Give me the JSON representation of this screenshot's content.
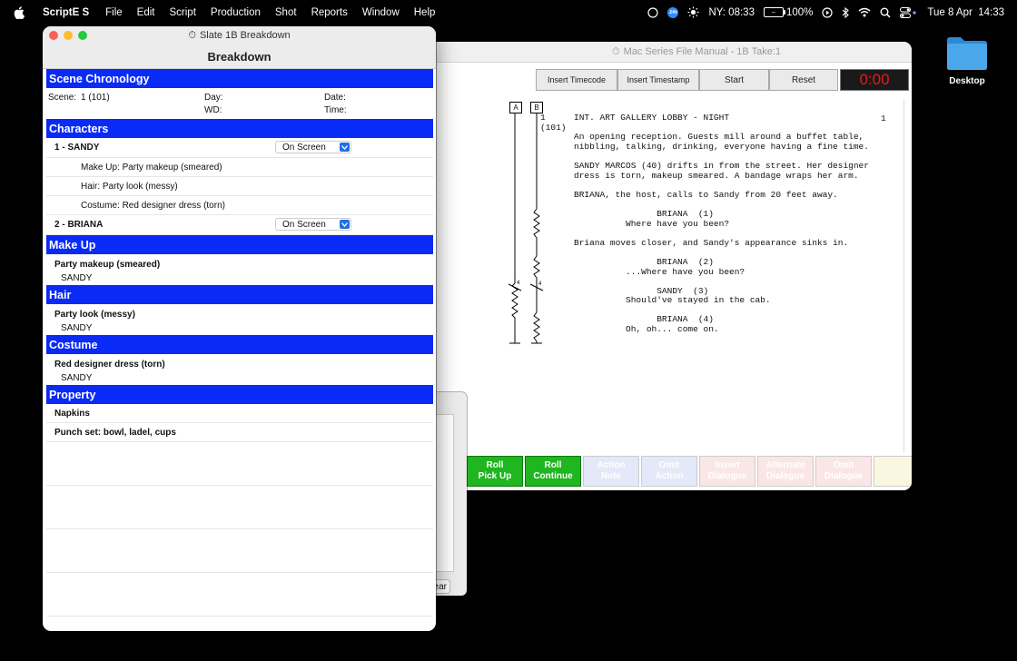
{
  "menubar": {
    "app_name": "ScriptE S",
    "menus": [
      "File",
      "Edit",
      "Script",
      "Production",
      "Shot",
      "Reports",
      "Window",
      "Help"
    ],
    "zoom_badge": "zm",
    "clock_ny": "NY: 08:33",
    "battery": "100%",
    "date_time": "Tue 8 Apr  14:33"
  },
  "desktop": {
    "folder_label": "Desktop"
  },
  "back_window": {
    "title": "Mac Series File Manual - 1B Take:1",
    "toolbar": {
      "insert_timecode": "Insert Timecode",
      "insert_timestamp": "Insert Timestamp",
      "start": "Start",
      "reset": "Reset",
      "timer": "0:00"
    },
    "camera_a": "A",
    "camera_b": "B",
    "scene_left": "1\n(101)",
    "scene_right": "1",
    "script_lines": "INT. ART GALLERY LOBBY - NIGHT\n\nAn opening reception. Guests mill around a buffet table,\nnibbling, talking, drinking, everyone having a fine time.\n\nSANDY MARCOS (40) drifts in from the street. Her designer\ndress is torn, makeup smeared. A bandage wraps her arm.\n\nBRIANA, the host, calls to Sandy from 20 feet away.\n\n                BRIANA  (1)\n          Where have you been?\n\nBriana moves closer, and Sandy's appearance sinks in.\n\n                BRIANA  (2)\n          ...Where have you been?\n\n                SANDY  (3)\n          Should've stayed in the cab.\n\n                BRIANA  (4)\n          Oh, oh... come on.",
    "bottom_buttons": [
      {
        "label": "Roll\nPick Up",
        "style": "green"
      },
      {
        "label": "Roll\nContinue",
        "style": "green"
      },
      {
        "label": "Action\nNote",
        "style": "blue"
      },
      {
        "label": "Omit\nAction",
        "style": "blue"
      },
      {
        "label": "Insert\nDialogue",
        "style": "pink"
      },
      {
        "label": "Alternate\nDialogue",
        "style": "pink"
      },
      {
        "label": "Omit\nDialogue",
        "style": "pink"
      },
      {
        "label": "",
        "style": "yellow"
      }
    ]
  },
  "middle_window": {
    "clear_label": "ear"
  },
  "breakdown_window": {
    "title": "Slate 1B Breakdown",
    "heading": "Breakdown",
    "scene_chronology": {
      "header": "Scene Chronology",
      "scene_label": "Scene:",
      "scene_value": "1 (101)",
      "day_label": "Day:",
      "wd_label": "WD:",
      "date_label": "Date:",
      "time_label": "Time:"
    },
    "characters": {
      "header": "Characters",
      "list": [
        {
          "name": "1 - SANDY",
          "status": "On Screen",
          "details": [
            "Make Up: Party makeup (smeared)",
            "Hair: Party look (messy)",
            "Costume: Red designer dress (torn)"
          ]
        },
        {
          "name": "2 - BRIANA",
          "status": "On Screen",
          "details": []
        }
      ]
    },
    "make_up": {
      "header": "Make Up",
      "item": "Party makeup (smeared)",
      "who": "SANDY"
    },
    "hair": {
      "header": "Hair",
      "item": "Party look (messy)",
      "who": "SANDY"
    },
    "costume": {
      "header": "Costume",
      "item": "Red designer dress (torn)",
      "who": "SANDY"
    },
    "property": {
      "header": "Property",
      "items": [
        "Napkins",
        "Punch set: bowl, ladel, cups"
      ]
    }
  },
  "colors": {
    "section_header": "#0a2af5",
    "timer_text": "#e21c1c",
    "roll_button": "#1fb61f"
  }
}
